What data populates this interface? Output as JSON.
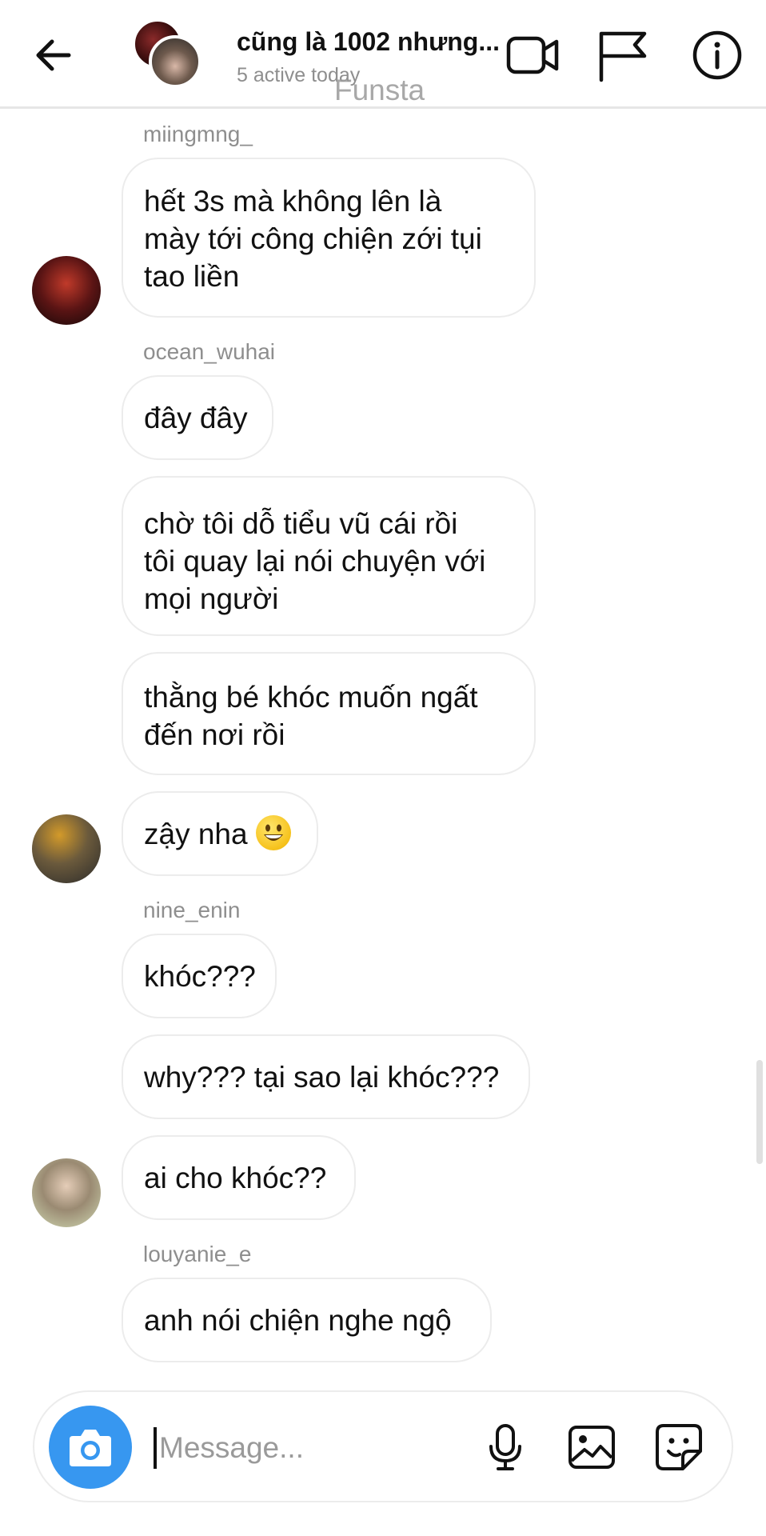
{
  "header": {
    "title": "cũng là 1002 nhưng...",
    "subtitle": "5 active today",
    "watermark": "Funsta"
  },
  "icons": {
    "back": "back-arrow-icon",
    "video": "video-call-icon",
    "flag": "flag-icon",
    "info": "info-icon",
    "camera": "camera-icon",
    "mic": "microphone-icon",
    "gallery": "gallery-icon",
    "sticker": "sticker-icon"
  },
  "colors": {
    "accent": "#3797f0",
    "bubble_border": "#ececec",
    "muted": "#8e8e8e"
  },
  "messages": [
    {
      "username": "miingmng_"
    },
    {
      "lines": [
        "hết 3s mà không lên là",
        "mày tới công chiện zới tụi",
        "tao liền"
      ]
    },
    {
      "username": "ocean_wuhai"
    },
    {
      "lines": [
        "đây đây"
      ]
    },
    {
      "lines": [
        "chờ tôi dỗ tiểu vũ cái rồi",
        "tôi quay lại nói chuyện với",
        "mọi người"
      ]
    },
    {
      "lines": [
        "thằng bé khóc muốn ngất",
        "đến nơi rồi"
      ]
    },
    {
      "lines": [
        "zậy nha"
      ],
      "emoji": "grinning-face"
    },
    {
      "username": "nine_enin"
    },
    {
      "lines": [
        "khóc???"
      ]
    },
    {
      "lines": [
        "why??? tại sao lại khóc???"
      ]
    },
    {
      "lines": [
        "ai cho khóc??"
      ]
    },
    {
      "username": "louyanie_e"
    },
    {
      "lines": [
        "anh nói chiện nghe ngộ"
      ]
    }
  ],
  "composer": {
    "placeholder": "Message..."
  }
}
